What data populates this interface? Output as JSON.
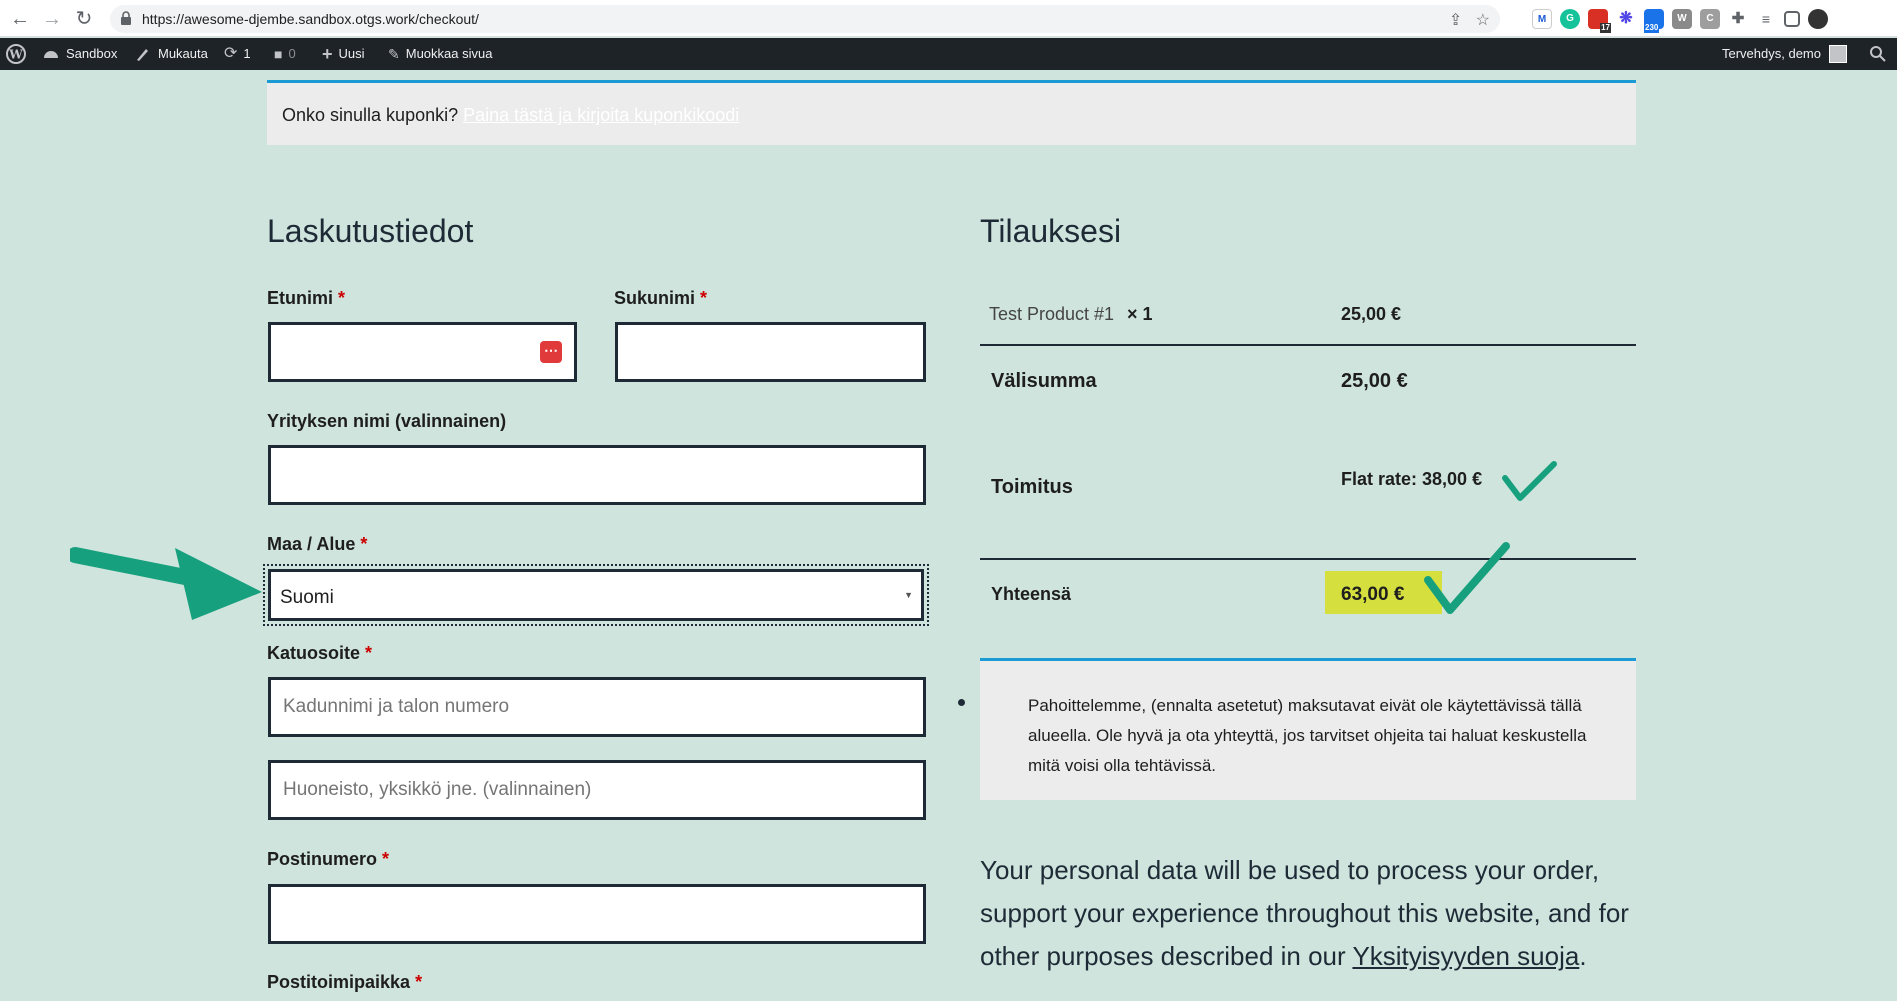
{
  "browser": {
    "url": "https://awesome-djembe.sandbox.otgs.work/checkout/",
    "ext_badge_1": "17",
    "ext_badge_2": "230"
  },
  "admin_bar": {
    "site": "Sandbox",
    "customize": "Mukauta",
    "updates": "1",
    "comments": "0",
    "new": "Uusi",
    "edit_page": "Muokkaa sivua",
    "greeting": "Tervehdys, demo"
  },
  "coupon": {
    "prompt": "Onko sinulla kuponki?",
    "link": "Paina tästä ja kirjoita kuponkikoodi"
  },
  "billing": {
    "heading": "Laskutustiedot",
    "first_name_label": "Etunimi",
    "last_name_label": "Sukunimi",
    "company_label": "Yrityksen nimi (valinnainen)",
    "country_label": "Maa / Alue",
    "country_value": "Suomi",
    "street_label": "Katuosoite",
    "street_placeholder": "Kadunnimi ja talon numero",
    "apartment_placeholder": "Huoneisto, yksikkö jne. (valinnainen)",
    "postcode_label": "Postinumero",
    "city_label": "Postitoimipaikka",
    "required_mark": "*"
  },
  "order": {
    "heading": "Tilauksesi",
    "product_name": "Test Product #1",
    "product_qty": "× 1",
    "product_price": "25,00 €",
    "subtotal_label": "Välisumma",
    "subtotal_value": "25,00 €",
    "shipping_label": "Toimitus",
    "shipping_value": "Flat rate: 38,00 €",
    "total_label": "Yhteensä",
    "total_value": "63,00 €"
  },
  "notice": {
    "text": "Pahoittelemme, (ennalta asetetut) maksutavat eivät ole käytettävissä tällä alueella. Ole hyvä ja ota yhteyttä, jos tarvitset ohjeita tai haluat keskustella mitä voisi olla tehtävissä."
  },
  "privacy": {
    "text": "Your personal data will be used to process your order, support your experience throughout this website, and for other purposes described in our",
    "link": "Yksityisyyden suoja",
    "end": "."
  },
  "colors": {
    "page_bg": "#cfe4dc",
    "accent": "#1c9ad4",
    "annotation": "#17a07e",
    "highlight": "#d5e03f"
  }
}
